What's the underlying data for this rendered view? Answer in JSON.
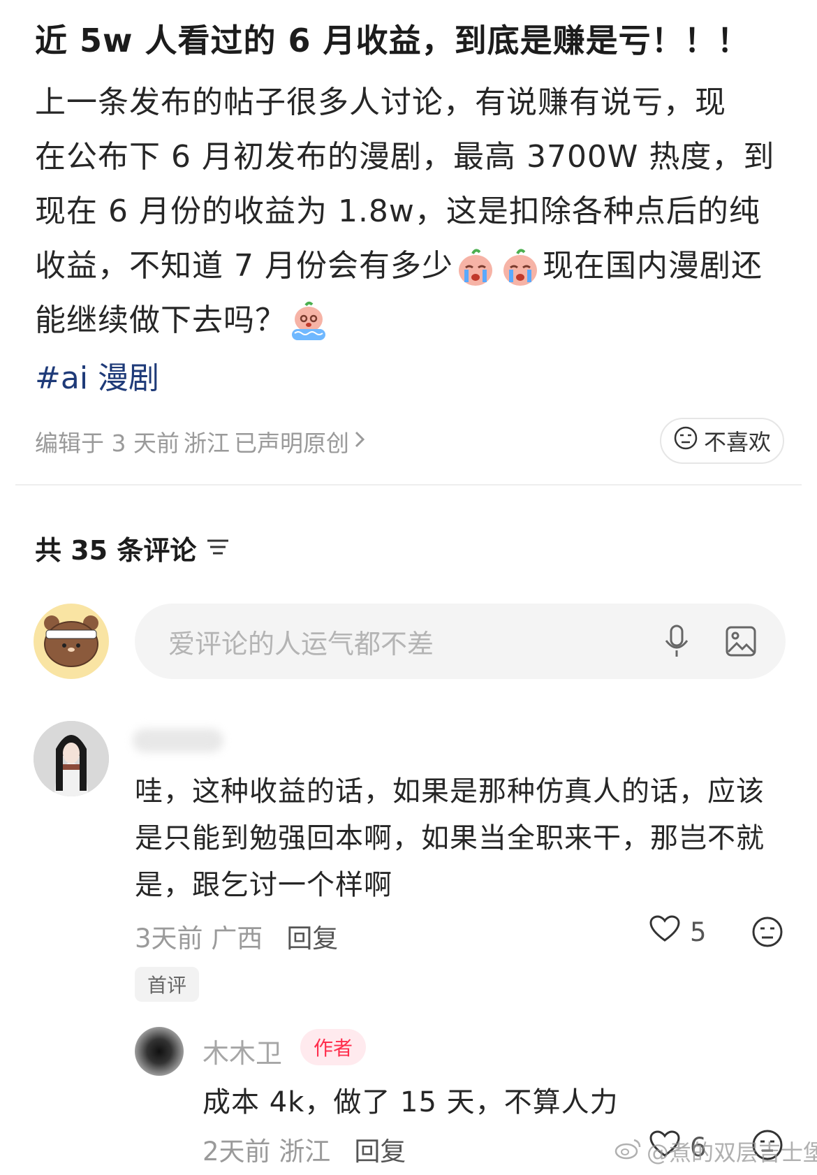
{
  "post": {
    "title": "近 5w 人看过的 6 月收益，到底是赚是亏！！！",
    "body_line1": "上一条发布的帖子很多人讨论，有说赚有说亏，现",
    "body_line2": "在公布下 6 月初发布的漫剧，最高 3700W 热度，到",
    "body_line3": "现在 6 月份的收益为 1.8w，这是扣除各种点后的纯",
    "body_line4a": "收益，不知道 7 月份会有多少",
    "body_line4b": "现在国内漫剧还",
    "body_line5": "能继续做下去吗？",
    "tag": "#ai 漫剧",
    "meta_edited": "编辑于 3 天前",
    "meta_location": "浙江",
    "meta_original": "已声明原创",
    "dislike_label": "不喜欢"
  },
  "comments_header": {
    "label": "共 35 条评论"
  },
  "comment_input": {
    "placeholder": "爱评论的人运气都不差"
  },
  "comment": {
    "text": "哇，这种收益的话，如果是那种仿真人的话，应该是只能到勉强回本啊，如果当全职来干，那岂不就是，跟乞讨一个样啊",
    "time": "3天前",
    "location": "广西",
    "reply_label": "回复",
    "likes": "5",
    "first_badge": "首评"
  },
  "reply": {
    "name": "木木卫",
    "author_badge": "作者",
    "text": "成本 4k，做了 15 天，不算人力",
    "time": "2天前",
    "location": "浙江",
    "reply_label": "回复",
    "likes": "6"
  },
  "watermark": {
    "text": "@煮的双层吉士堡"
  },
  "colors": {
    "tag": "#1e3a78",
    "author_badge_bg": "#ffeaee",
    "author_badge_text": "#ff2e4d",
    "input_bg": "#f4f4f4"
  },
  "icons": [
    "crying-emoji-icon",
    "crying-emoji-icon",
    "sob-emoji-icon",
    "chevron-right-icon",
    "dislike-face-icon",
    "sort-icon",
    "microphone-icon",
    "image-icon",
    "heart-icon"
  ]
}
